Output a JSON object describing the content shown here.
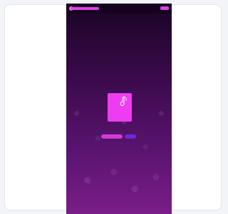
{
  "page": {
    "accent": "#e040e8",
    "background": "#3a0a4a"
  },
  "nav": {
    "items": [
      "",
      "",
      "",
      "",
      ""
    ],
    "cta_label": ""
  },
  "hero": {
    "eyebrow": "",
    "cover_title": "",
    "caption": "",
    "primary_button": "",
    "secondary_button": ""
  }
}
